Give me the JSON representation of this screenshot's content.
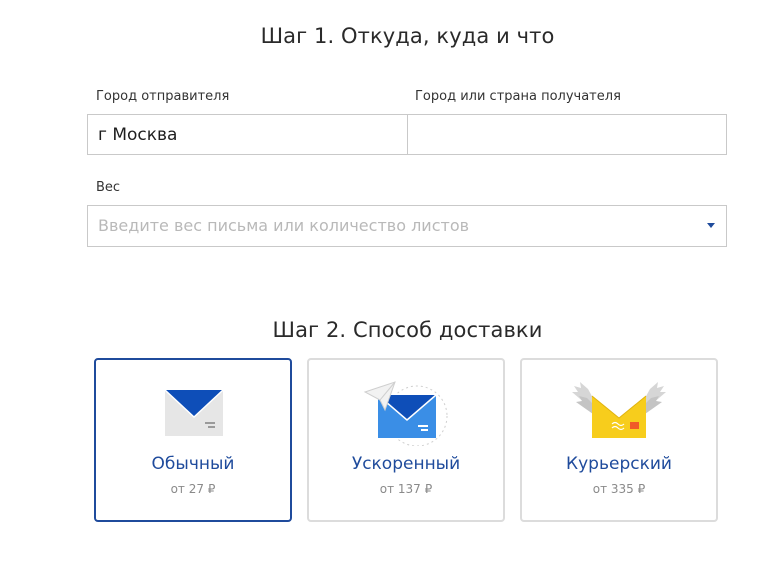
{
  "step1": {
    "title": "Шаг 1. Откуда, куда и что",
    "sender_city": {
      "label": "Город отправителя",
      "value": "г Москва"
    },
    "recipient_city": {
      "label": "Город или страна получателя",
      "value": ""
    },
    "weight": {
      "label": "Вес",
      "placeholder": "Введите вес письма или количество листов"
    }
  },
  "step2": {
    "title": "Шаг 2. Способ доставки",
    "options": [
      {
        "title": "Обычный",
        "price": "от 27 ₽",
        "icon": "envelope-icon",
        "selected": true
      },
      {
        "title": "Ускоренный",
        "price": "от 137 ₽",
        "icon": "paper-plane-envelope-icon",
        "selected": false
      },
      {
        "title": "Курьерский",
        "price": "от 335 ₽",
        "icon": "winged-envelope-icon",
        "selected": false
      }
    ]
  },
  "colors": {
    "accent": "#1f4b9c",
    "envelope_blue": "#0e4eb8",
    "envelope_light_blue": "#3a8ee6",
    "envelope_gray": "#e5e5e5",
    "envelope_yellow": "#f7cd1c",
    "border": "#c9c9c9"
  }
}
